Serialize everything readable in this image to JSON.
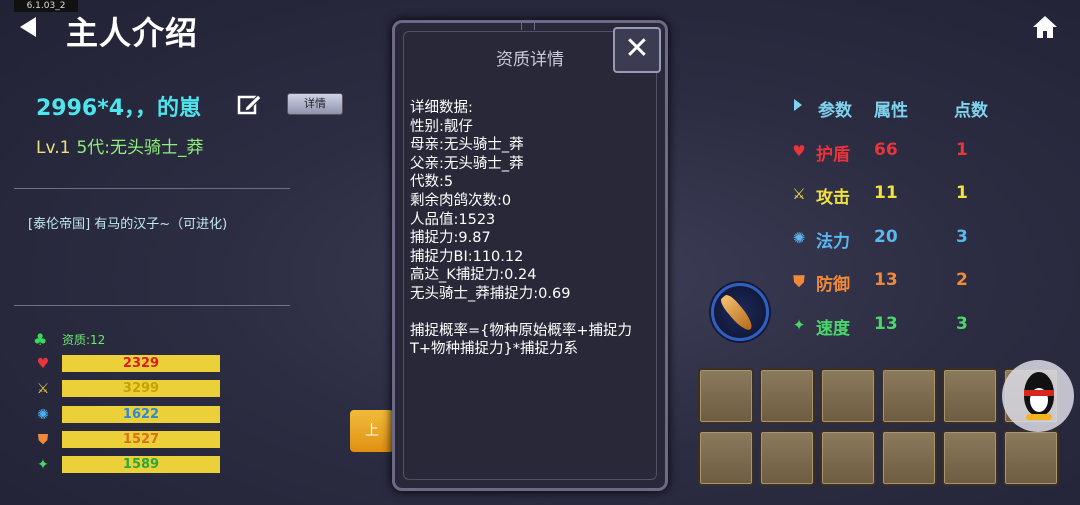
{
  "version": "6.1.03_2",
  "header": {
    "title": "主人介绍"
  },
  "pet": {
    "name": "2996*4，，的崽",
    "detail_button": "详情",
    "level": "Lv.1",
    "generation": "5代:无头骑士_莽",
    "tribe": "[泰伦帝国] 有马的汉子~（可进化)",
    "quality": "资质:12",
    "bars": [
      {
        "icon": "heart-icon",
        "glyph": "♥",
        "icon_color": "#e8343a",
        "value": "2329",
        "text_color": "#d81e1e"
      },
      {
        "icon": "sword-icon",
        "glyph": "⚔",
        "icon_color": "#e8d23a",
        "value": "3299",
        "text_color": "#c8a200"
      },
      {
        "icon": "sun-icon",
        "glyph": "✺",
        "icon_color": "#4ab0f0",
        "value": "1622",
        "text_color": "#2a8ad8"
      },
      {
        "icon": "shield-icon",
        "glyph": "⛊",
        "icon_color": "#f08a3a",
        "value": "1527",
        "text_color": "#d8701e"
      },
      {
        "icon": "wing-icon",
        "glyph": "✦",
        "icon_color": "#4ad86a",
        "value": "1589",
        "text_color": "#2aa83a"
      }
    ],
    "tab_label": "上"
  },
  "modal": {
    "title": "资质详情",
    "close": "✕",
    "lines": [
      "详细数据:",
      "性别:靓仔",
      "母亲:无头骑士_莽",
      "父亲:无头骑士_莽",
      "代数:5",
      "剩余肉鸽次数:0",
      "人品值:1523",
      "捕捉力:9.87",
      "捕捉力BI:110.12",
      "高达_K捕捉力:0.24",
      "无头骑士_莽捕捉力:0.69",
      "",
      "捕捉概率={物种原始概率+捕捉力",
      "T+物种捕捉力}*捕捉力系"
    ]
  },
  "attributes": {
    "headers": {
      "param": "参数",
      "attr": "属性",
      "points": "点数"
    },
    "rows": [
      {
        "icon": "heart-icon",
        "glyph": "♥",
        "name": "护盾",
        "value": "66",
        "points": "1",
        "color": "#e8343a"
      },
      {
        "icon": "sword-icon",
        "glyph": "⚔",
        "name": "攻击",
        "value": "11",
        "points": "1",
        "color": "#f2e23a"
      },
      {
        "icon": "sun-icon",
        "glyph": "✺",
        "name": "法力",
        "value": "20",
        "points": "3",
        "color": "#5ab8f0"
      },
      {
        "icon": "shield-icon",
        "glyph": "⛊",
        "name": "防御",
        "value": "13",
        "points": "2",
        "color": "#f08a3a"
      },
      {
        "icon": "wing-icon",
        "glyph": "✦",
        "name": "速度",
        "value": "13",
        "points": "3",
        "color": "#4ad86a"
      }
    ]
  }
}
